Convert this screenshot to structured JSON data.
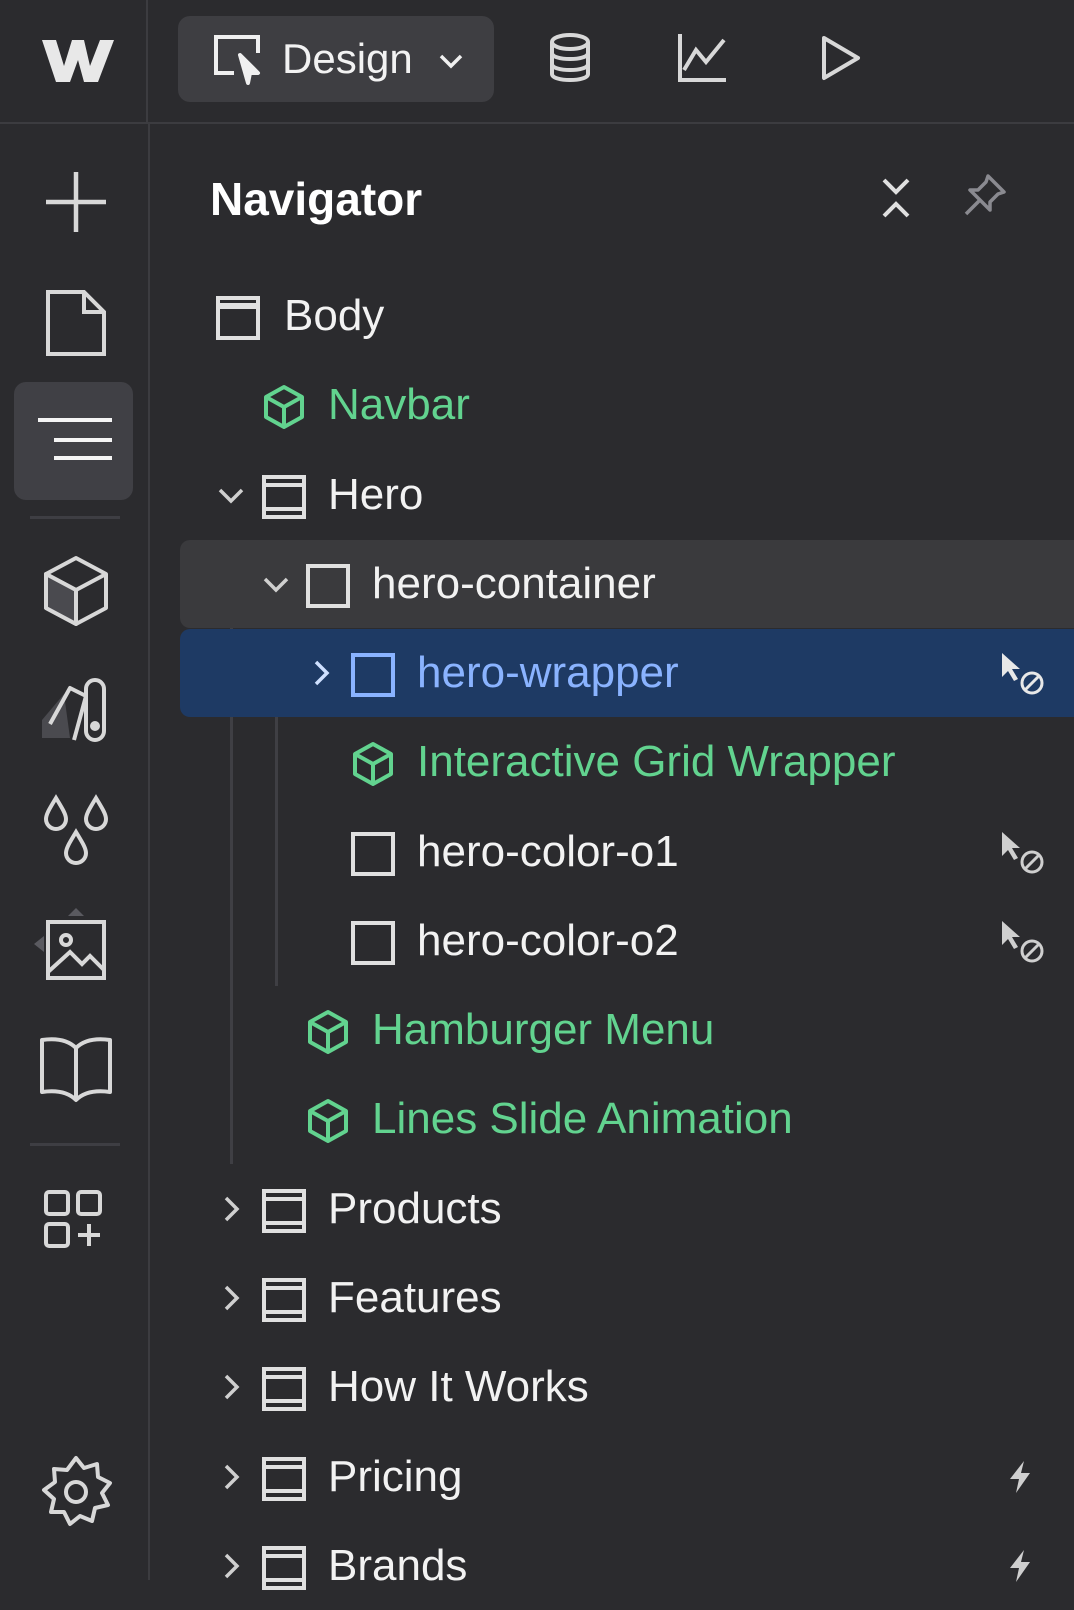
{
  "header": {
    "mode_label": "Design",
    "icons": [
      "webflow-logo-icon",
      "design-mode-icon",
      "chevron-down-icon",
      "cms-database-icon",
      "analytics-icon",
      "preview-play-icon"
    ]
  },
  "rail": {
    "items": [
      "add-icon",
      "pages-icon",
      "navigator-icon",
      "components-icon",
      "style-selector-icon",
      "variables-icon",
      "assets-icon",
      "libraries-icon",
      "apps-icon",
      "settings-icon"
    ]
  },
  "navigator": {
    "title": "Navigator",
    "rows": [
      {
        "label": "Body",
        "type": "body",
        "color": "white"
      },
      {
        "label": "Navbar",
        "type": "component",
        "color": "green"
      },
      {
        "label": "Hero",
        "type": "section",
        "color": "white",
        "expanded": true
      },
      {
        "label": "hero-container",
        "type": "div",
        "color": "white",
        "expanded": true,
        "hovered": true
      },
      {
        "label": "hero-wrapper",
        "type": "div",
        "color": "blue",
        "collapsed": true,
        "selected": true
      },
      {
        "label": "Interactive Grid Wrapper",
        "type": "component",
        "color": "green"
      },
      {
        "label": "hero-color-o1",
        "type": "div",
        "color": "white"
      },
      {
        "label": "hero-color-o2",
        "type": "div",
        "color": "white"
      },
      {
        "label": "Hamburger Menu",
        "type": "component",
        "color": "green"
      },
      {
        "label": "Lines Slide Animation",
        "type": "component",
        "color": "green"
      },
      {
        "label": "Products",
        "type": "section",
        "color": "white",
        "collapsed": true
      },
      {
        "label": "Features",
        "type": "section",
        "color": "white",
        "collapsed": true
      },
      {
        "label": "How It Works",
        "type": "section",
        "color": "white",
        "collapsed": true
      },
      {
        "label": "Pricing",
        "type": "section",
        "color": "white",
        "collapsed": true,
        "interaction": true
      },
      {
        "label": "Brands",
        "type": "section",
        "color": "white",
        "collapsed": true,
        "interaction": true
      }
    ]
  },
  "colors": {
    "background": "#2b2b2e",
    "selected_row": "#1e3a64",
    "component_green": "#62d38f",
    "selected_blue": "#8ab3ff"
  }
}
